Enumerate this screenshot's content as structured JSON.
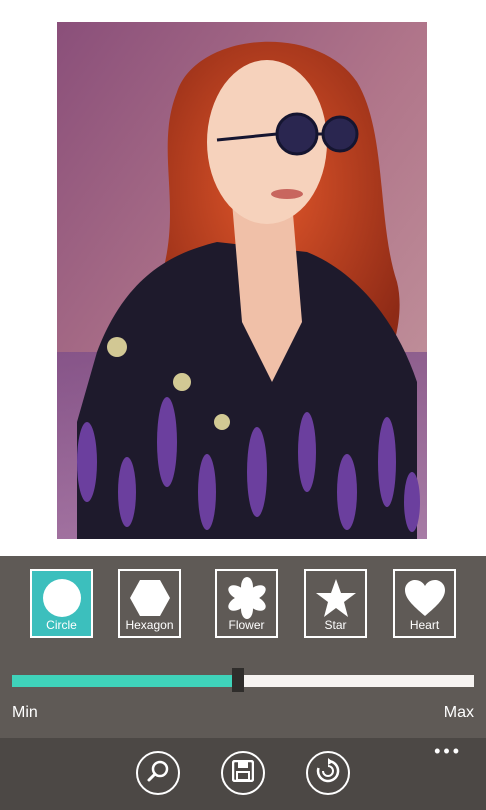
{
  "photo": {
    "description_icon": "portrait-photo"
  },
  "shapes": [
    {
      "label": "Circle",
      "icon": "circle-icon",
      "selected": true
    },
    {
      "label": "Hexagon",
      "icon": "hexagon-icon",
      "selected": false
    },
    {
      "label": "Flower",
      "icon": "flower-icon",
      "selected": false
    },
    {
      "label": "Star",
      "icon": "star-icon",
      "selected": false
    },
    {
      "label": "Heart",
      "icon": "heart-icon",
      "selected": false
    }
  ],
  "slider": {
    "min_label": "Min",
    "max_label": "Max",
    "value_fraction": 0.49
  },
  "app_bar": {
    "buttons": [
      "zoom-icon",
      "save-icon",
      "rotate-icon"
    ],
    "more": "•••"
  },
  "colors": {
    "accent": "#3cbfbd",
    "slider_fill": "#3fd3ba",
    "panel": "#5f5a56",
    "app_bar": "#4c4845"
  }
}
